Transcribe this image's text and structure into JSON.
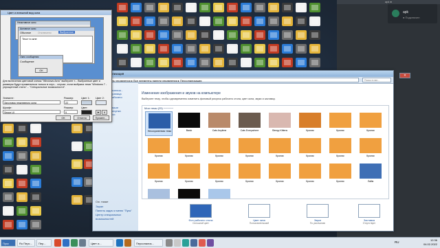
{
  "remote": {
    "top_label": "apk ●",
    "user_name": "apk",
    "user_status": "● Подключен"
  },
  "desktop_icons": [
    {
      "label": "",
      "color": "#c23b22"
    },
    {
      "label": "",
      "color": "#2b7bd6"
    },
    {
      "label": "",
      "color": "#6b6b6b"
    },
    {
      "label": "",
      "color": "#e4b43a"
    },
    {
      "label": "",
      "color": "#3a3a3a"
    },
    {
      "label": "",
      "color": "#f2f2f2"
    },
    {
      "label": "",
      "color": "#4f8f2f"
    },
    {
      "label": "",
      "color": "#e8c84a"
    }
  ],
  "taskbar": {
    "items": [
      "Пуск",
      "Ru Перс...",
      "Пер...",
      "Цвет и...",
      "",
      "Персонализ..."
    ],
    "lang": "RU",
    "time": "12:36",
    "date": "04.02.2022"
  },
  "personalization": {
    "title": "Персонализация",
    "breadcrumb": "▸ Панель управления ▸ Все элементы панели управления ▸ Персонализация",
    "search_placeholder": "Поиск в пан...",
    "sidebar_links": [
      "Панель управления -",
      "домашняя страница",
      "Изменение рабочего",
      "стола",
      "Изменение",
      "указателей мыши",
      "Изменение рисунка",
      "учетной записи"
    ],
    "see_also_title": "См. также",
    "see_also": [
      "Экран",
      "Панель задач и меню \"Пуск\"",
      "Центр специальных",
      "возможностей"
    ],
    "heading": "Изменение изображения и звуков на компьютере",
    "subheading": "Выберите тему, чтобы одновременно изменить фоновый рисунок рабочего стола, цвет окна, звуки и заставку.",
    "group_label": "Мои темы (25) ─────",
    "themes": [
      {
        "label": "Несохраненная тема",
        "color": "#2c5ea8",
        "selected": true
      },
      {
        "label": "Basic",
        "color": "#0a0a0a"
      },
      {
        "label": "Cats Anytime",
        "color": "#b98a6a"
      },
      {
        "label": "Cats Everywhere",
        "color": "#6b5b4e"
      },
      {
        "label": "Sleepy Kittens",
        "color": "#d9b8b0"
      },
      {
        "label": "Кролик",
        "color": "#d87e2a"
      },
      {
        "label": "Кролик",
        "color": "#f0a040"
      },
      {
        "label": "Кролик",
        "color": "#f0a040"
      },
      {
        "label": "Кролик",
        "color": "#f0a040"
      },
      {
        "label": "Кролик",
        "color": "#f0a040"
      },
      {
        "label": "Кролик",
        "color": "#f0a040"
      },
      {
        "label": "Кролик",
        "color": "#f0a040"
      },
      {
        "label": "Кролик",
        "color": "#f0a040"
      },
      {
        "label": "Кролик",
        "color": "#f0a040"
      },
      {
        "label": "Кролик",
        "color": "#f0a040"
      },
      {
        "label": "Кролик",
        "color": "#f0a040"
      },
      {
        "label": "Кролик",
        "color": "#f0a040"
      },
      {
        "label": "Кролик",
        "color": "#f0a040"
      },
      {
        "label": "Кролик",
        "color": "#f0a040"
      },
      {
        "label": "Кролик",
        "color": "#f0a040"
      },
      {
        "label": "Кролик",
        "color": "#f0a040"
      },
      {
        "label": "Кролик",
        "color": "#f0a040"
      },
      {
        "label": "Кролик",
        "color": "#f0a040"
      },
      {
        "label": "Лайм",
        "color": "#3f6fb5"
      },
      {
        "label": "Мой любимый классическая",
        "color": "#a9c0df"
      },
      {
        "label": "Олесуми",
        "color": "#0a0a0a"
      },
      {
        "label": "Олесуми",
        "color": "#a9c7ea"
      }
    ],
    "bottom": [
      {
        "label": "Фон рабочего стола",
        "sub": "Сплошной цвет",
        "color": "#2f66b8"
      },
      {
        "label": "Цвет окна",
        "sub": "Пользовательский",
        "color": "#ffffff"
      },
      {
        "label": "Звуки",
        "sub": "По умолчанию",
        "color": "#ffffff"
      },
      {
        "label": "Заставка",
        "sub": "Отсутствует",
        "color": "#ffffff"
      }
    ]
  },
  "appearance": {
    "title": "Цвет и внешний вид окна",
    "preview_inactive": "Неактивное окно",
    "preview_active": "Активное окно",
    "preview_menu": [
      "Обычное",
      "Отключено",
      "Выбранное"
    ],
    "preview_text": "Текст в окне",
    "preview_msgbox": "Окно сообщения",
    "preview_msgtext": "Сообщение",
    "preview_ok": "OK",
    "description": "Для включения цветовой схемы \"Windows Aero\" выберите т... Выбранные цвет и размеры будут применяться только в случ... случае, если выбрана тема \"Windows 7 - упрощенный стиль\"... \"Специальные возможности\".",
    "element_label": "Элемент:",
    "element_value": "Заголовок неактивного окна",
    "size_label": "Размер:",
    "size_value": "22",
    "color1_label": "Цвет 1:",
    "color2_label": "Цвет 2:",
    "font_label": "Шрифт:",
    "font_value": "Segoe UI",
    "font_size_label": "Размер:",
    "font_size_value": "9",
    "font_color_label": "Цвет:",
    "ok": "ОК",
    "cancel": "Отмена",
    "apply": "Примен..."
  }
}
